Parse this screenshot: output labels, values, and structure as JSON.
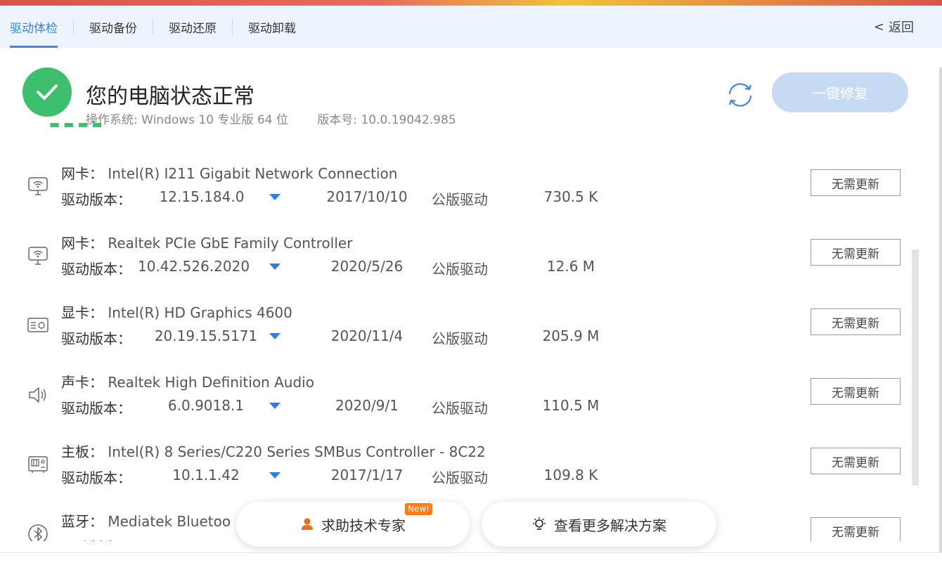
{
  "tabs": [
    {
      "label": "驱动体检",
      "active": true
    },
    {
      "label": "驱动备份",
      "active": false
    },
    {
      "label": "驱动还原",
      "active": false
    },
    {
      "label": "驱动卸载",
      "active": false
    }
  ],
  "back": {
    "label": "返回",
    "icon": "chevron-left-icon"
  },
  "status": {
    "title": "您的电脑状态正常",
    "os": "操作系统: Windows 10 专业版 64 位",
    "version": "版本号: 10.0.19042.985",
    "fix_label": "一键修复",
    "colors": {
      "ok": "#3dbf6d",
      "accent": "#3b86e5",
      "fix_disabled": "#c7daf3"
    }
  },
  "version_label": "驱动版本：",
  "no_update_label": "无需更新",
  "drivers": [
    {
      "type": "网卡：",
      "name": "Intel(R) I211 Gigabit Network Connection",
      "version": "12.15.184.0",
      "date": "2017/10/10",
      "kind": "公版驱动",
      "size": "730.5 K",
      "icon": "network-card-icon"
    },
    {
      "type": "网卡：",
      "name": "Realtek PCIe GbE Family Controller",
      "version": "10.42.526.2020",
      "date": "2020/5/26",
      "kind": "公版驱动",
      "size": "12.6 M",
      "icon": "network-card-icon"
    },
    {
      "type": "显卡：",
      "name": "Intel(R) HD Graphics 4600",
      "version": "20.19.15.5171",
      "date": "2020/11/4",
      "kind": "公版驱动",
      "size": "205.9 M",
      "icon": "graphics-card-icon"
    },
    {
      "type": "声卡：",
      "name": "Realtek High Definition Audio",
      "version": "6.0.9018.1",
      "date": "2020/9/1",
      "kind": "公版驱动",
      "size": "110.5 M",
      "icon": "speaker-icon"
    },
    {
      "type": "主板：",
      "name": "Intel(R) 8 Series/C220 Series SMBus Controller - 8C22",
      "version": "10.1.1.42",
      "date": "2017/1/17",
      "kind": "公版驱动",
      "size": "109.8 K",
      "icon": "motherboard-icon"
    },
    {
      "type": "蓝牙：",
      "name": "Mediatek Bluetoo",
      "version": "",
      "date": "",
      "kind": "",
      "size": "",
      "icon": "bluetooth-icon"
    }
  ],
  "help": {
    "expert_label": "求助技术专家",
    "badge": "New!",
    "more_label": "查看更多解决方案"
  }
}
